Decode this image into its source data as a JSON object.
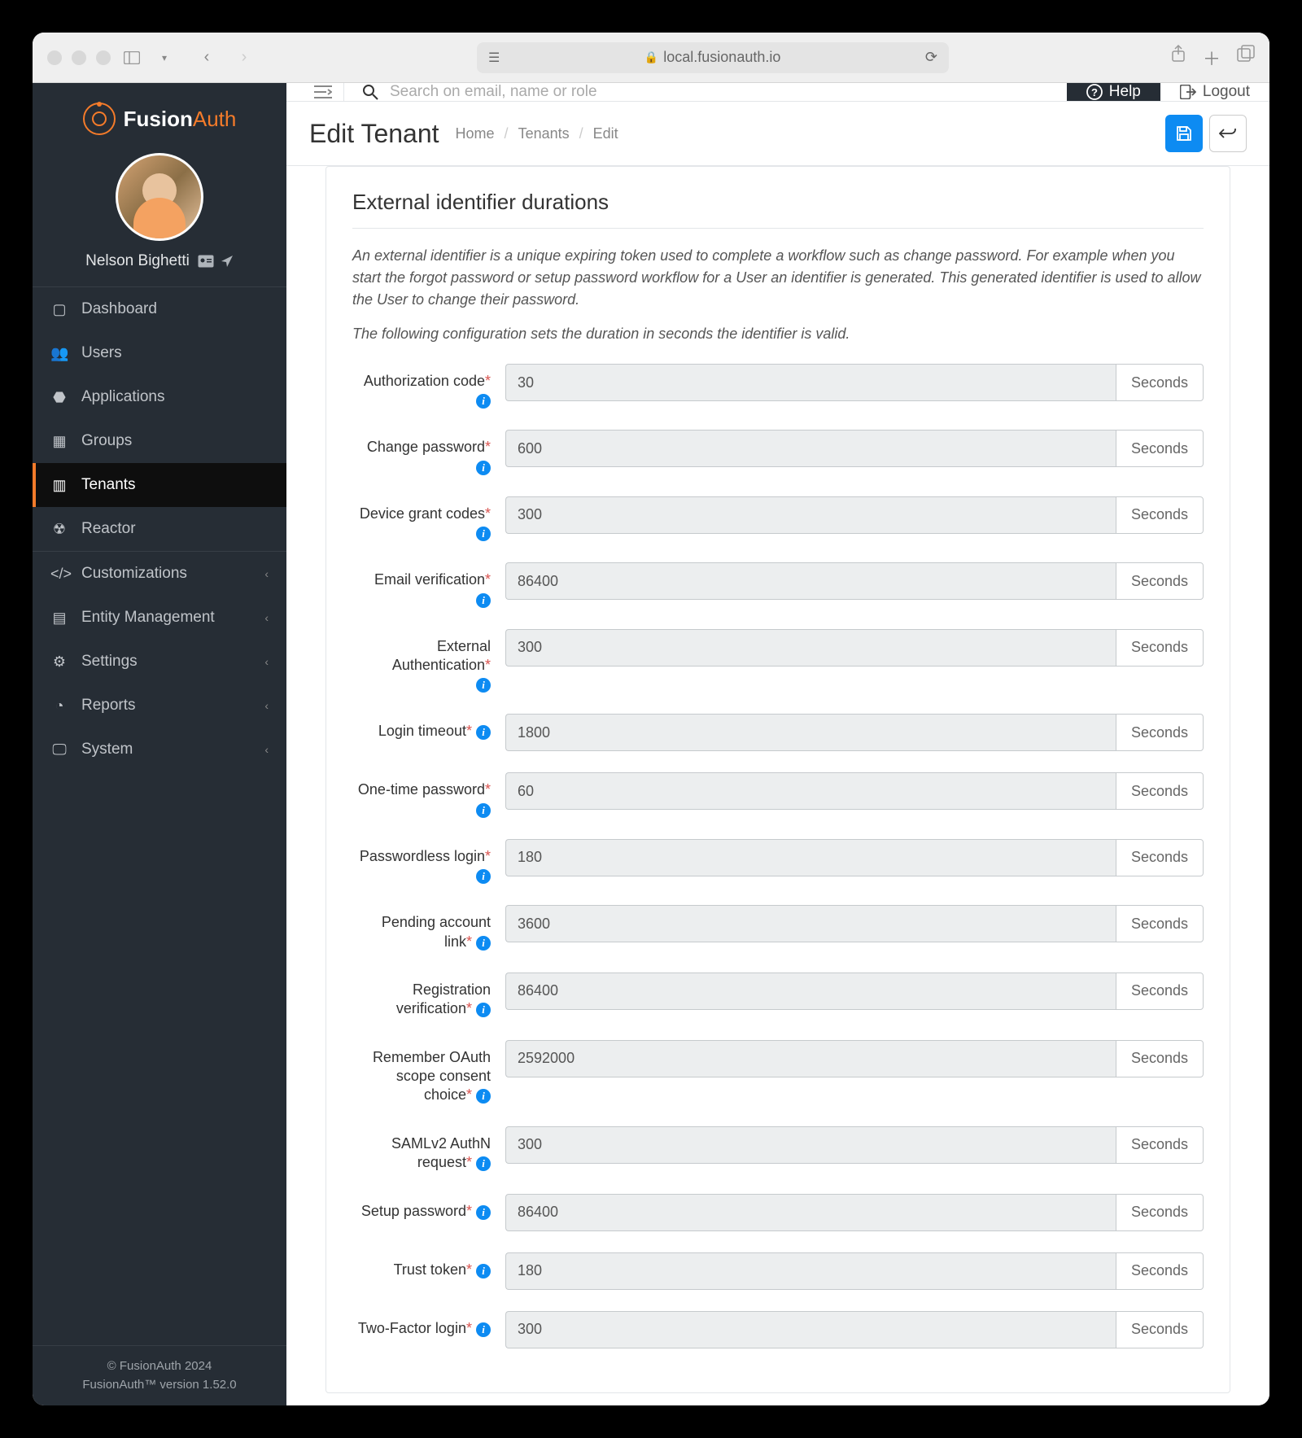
{
  "browser": {
    "url": "local.fusionauth.io"
  },
  "brand": {
    "name_primary": "Fusion",
    "name_accent": "Auth"
  },
  "user": {
    "name": "Nelson Bighetti"
  },
  "nav": {
    "items": [
      {
        "label": "Dashboard",
        "icon": "▢"
      },
      {
        "label": "Users",
        "icon": "👥"
      },
      {
        "label": "Applications",
        "icon": "⬣"
      },
      {
        "label": "Groups",
        "icon": "▦"
      },
      {
        "label": "Tenants",
        "icon": "▥",
        "active": true
      },
      {
        "label": "Reactor",
        "icon": "☢"
      },
      {
        "label": "Customizations",
        "icon": "</>",
        "expandable": true
      },
      {
        "label": "Entity Management",
        "icon": "▤",
        "expandable": true
      },
      {
        "label": "Settings",
        "icon": "⚙",
        "expandable": true
      },
      {
        "label": "Reports",
        "icon": "◔",
        "expandable": true
      },
      {
        "label": "System",
        "icon": "🖵",
        "expandable": true
      }
    ]
  },
  "footer": {
    "copyright": "© FusionAuth 2024",
    "version": "FusionAuth™ version 1.52.0"
  },
  "topbar": {
    "search_placeholder": "Search on email, name or role",
    "help": "Help",
    "logout": "Logout"
  },
  "page": {
    "title": "Edit Tenant",
    "breadcrumb": [
      "Home",
      "Tenants",
      "Edit"
    ]
  },
  "panel": {
    "title": "External identifier durations",
    "description": "An external identifier is a unique expiring token used to complete a workflow such as change password. For example when you start the forgot password or setup password workflow for a User an identifier is generated. This generated identifier is used to allow the User to change their password.",
    "subtext": "The following configuration sets the duration in seconds the identifier is valid.",
    "unit": "Seconds"
  },
  "fields": [
    {
      "label": "Authorization code",
      "required": true,
      "info_below": true,
      "value": "30"
    },
    {
      "label": "Change password",
      "required": true,
      "info_below": true,
      "value": "600"
    },
    {
      "label": "Device grant codes",
      "required": true,
      "info_below": true,
      "value": "300"
    },
    {
      "label": "Email verification",
      "required": true,
      "info_below": true,
      "value": "86400"
    },
    {
      "label": "External Authentication",
      "required": true,
      "info_below": true,
      "value": "300"
    },
    {
      "label": "Login timeout",
      "required": true,
      "info_inline": true,
      "value": "1800"
    },
    {
      "label": "One-time password",
      "required": true,
      "info_below": true,
      "value": "60"
    },
    {
      "label": "Passwordless login",
      "required": true,
      "info_below": true,
      "value": "180"
    },
    {
      "label": "Pending account link",
      "required": true,
      "info_inline": true,
      "value": "3600"
    },
    {
      "label": "Registration verification",
      "required": true,
      "info_inline": true,
      "value": "86400"
    },
    {
      "label": "Remember OAuth scope consent choice",
      "required": true,
      "info_inline": true,
      "value": "2592000"
    },
    {
      "label": "SAMLv2 AuthN request",
      "required": true,
      "info_inline": true,
      "value": "300"
    },
    {
      "label": "Setup password",
      "required": true,
      "info_inline": true,
      "value": "86400"
    },
    {
      "label": "Trust token",
      "required": true,
      "info_inline": true,
      "value": "180"
    },
    {
      "label": "Two-Factor login",
      "required": true,
      "info_inline": true,
      "value": "300"
    }
  ]
}
